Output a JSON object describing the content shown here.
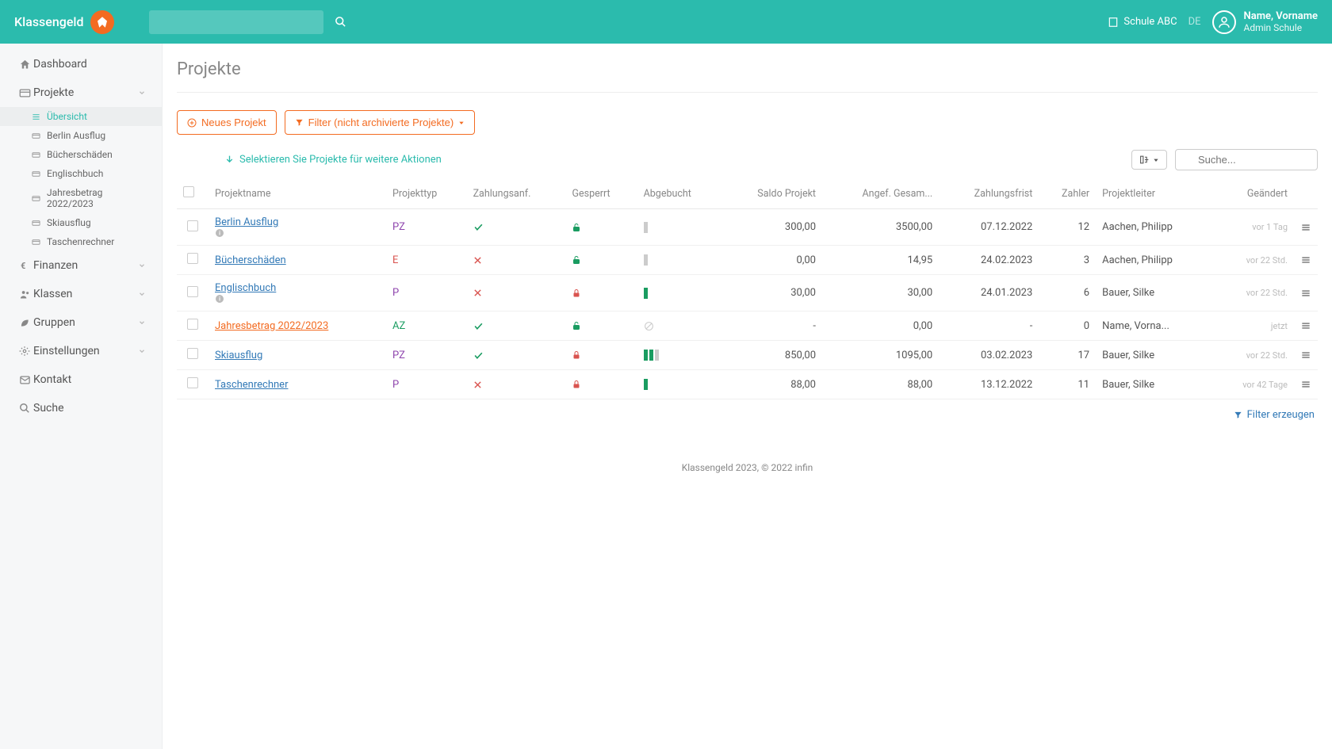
{
  "app": {
    "name": "Klassengeld"
  },
  "topbar": {
    "school_name": "Schule ABC",
    "lang": "DE",
    "user_name": "Name, Vorname",
    "user_role": "Admin Schule"
  },
  "sidebar": {
    "items": [
      {
        "label": "Dashboard"
      },
      {
        "label": "Projekte"
      },
      {
        "label": "Finanzen"
      },
      {
        "label": "Klassen"
      },
      {
        "label": "Gruppen"
      },
      {
        "label": "Einstellungen"
      },
      {
        "label": "Kontakt"
      },
      {
        "label": "Suche"
      }
    ],
    "sub": [
      {
        "label": "Übersicht"
      },
      {
        "label": "Berlin Ausflug"
      },
      {
        "label": "Bücherschäden"
      },
      {
        "label": "Englischbuch"
      },
      {
        "label": "Jahresbetrag 2022/2023"
      },
      {
        "label": "Skiausflug"
      },
      {
        "label": "Taschenrechner"
      }
    ]
  },
  "page": {
    "title": "Projekte",
    "new_btn": "Neues Projekt",
    "filter_btn": "Filter (nicht archivierte Projekte)",
    "hint": "Selektieren Sie Projekte für weitere Aktionen",
    "search_placeholder": "Suche...",
    "filter_link": "Filter erzeugen"
  },
  "table": {
    "headers": {
      "name": "Projektname",
      "type": "Projekttyp",
      "zahlungsanf": "Zahlungsanf.",
      "gesperrt": "Gesperrt",
      "abgebucht": "Abgebucht",
      "saldo": "Saldo Projekt",
      "angef": "Angef. Gesam...",
      "frist": "Zahlungsfrist",
      "zahler": "Zahler",
      "leiter": "Projektleiter",
      "geaendert": "Geändert"
    },
    "rows": [
      {
        "name": "Berlin Ausflug",
        "info": true,
        "type": "PZ",
        "type_cls": "ptype-pz",
        "za": "ok",
        "lock": "open",
        "bars": [
          false
        ],
        "saldo": "300,00",
        "angef": "3500,00",
        "frist": "07.12.2022",
        "zahler": "12",
        "leiter": "Aachen, Philipp",
        "geaendert": "vor 1 Tag"
      },
      {
        "name": "Bücherschäden",
        "info": false,
        "type": "E",
        "type_cls": "ptype-e",
        "za": "no",
        "lock": "open",
        "bars": [
          false
        ],
        "saldo": "0,00",
        "angef": "14,95",
        "frist": "24.02.2023",
        "zahler": "3",
        "leiter": "Aachen, Philipp",
        "geaendert": "vor 22 Std."
      },
      {
        "name": "Englischbuch",
        "info": true,
        "type": "P",
        "type_cls": "ptype-p",
        "za": "no",
        "lock": "closed",
        "bars": [
          true
        ],
        "saldo": "30,00",
        "angef": "30,00",
        "frist": "24.01.2023",
        "zahler": "6",
        "leiter": "Bauer, Silke",
        "geaendert": "vor 22 Std."
      },
      {
        "name": "Jahresbetrag 2022/2023",
        "orange": true,
        "info": false,
        "type": "AZ",
        "type_cls": "ptype-az",
        "za": "ok",
        "lock": "open",
        "bars": "disabled",
        "saldo": "-",
        "angef": "0,00",
        "frist": "-",
        "zahler": "0",
        "leiter": "Name, Vorna...",
        "geaendert": "jetzt"
      },
      {
        "name": "Skiausflug",
        "info": false,
        "type": "PZ",
        "type_cls": "ptype-pz",
        "za": "ok",
        "lock": "closed",
        "bars": [
          true,
          true,
          false
        ],
        "saldo": "850,00",
        "angef": "1095,00",
        "frist": "03.02.2023",
        "zahler": "17",
        "leiter": "Bauer, Silke",
        "geaendert": "vor 22 Std."
      },
      {
        "name": "Taschenrechner",
        "info": false,
        "type": "P",
        "type_cls": "ptype-p",
        "za": "no",
        "lock": "closed",
        "bars": [
          true
        ],
        "saldo": "88,00",
        "angef": "88,00",
        "frist": "13.12.2022",
        "zahler": "11",
        "leiter": "Bauer, Silke",
        "geaendert": "vor 42 Tage"
      }
    ]
  },
  "footer": "Klassengeld 2023, © 2022 infin"
}
